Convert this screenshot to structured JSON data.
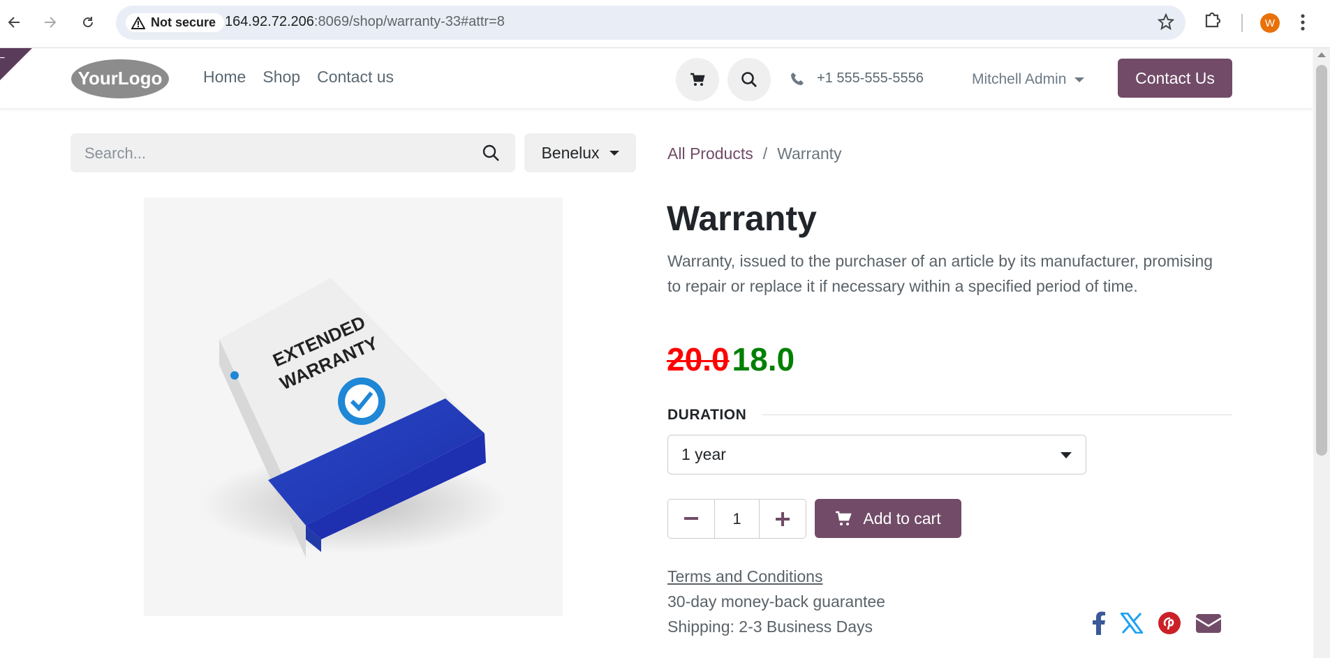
{
  "browser": {
    "security_label": "Not secure",
    "url_host": "164.92.72.206",
    "url_rest": ":8069/shop/warranty-33#attr=8",
    "profile_initial": "W"
  },
  "header": {
    "logo_text": "YourLogo",
    "menu": [
      "Home",
      "Shop",
      "Contact us"
    ],
    "phone": "+1 555-555-5556",
    "user": "Mitchell Admin",
    "cta": "Contact Us"
  },
  "search": {
    "placeholder": "Search...",
    "pricelist": "Benelux"
  },
  "breadcrumb": {
    "parent": "All Products",
    "separator": "/",
    "current": "Warranty"
  },
  "product": {
    "title": "Warranty",
    "description": "Warranty, issued to the purchaser of an article by its manufacturer, promising to repair or replace it if necessary within a specified period of time.",
    "old_price": "20.0",
    "price": "18.0",
    "image_text_1": "EXTENDED",
    "image_text_2": "WARRANTY",
    "attribute_label": "DURATION",
    "attribute_value": "1 year",
    "quantity": "1",
    "add_to_cart": "Add to cart",
    "terms": "Terms and Conditions",
    "guarantee": "30-day money-back guarantee",
    "shipping": "Shipping: 2-3 Business Days"
  },
  "colors": {
    "brand": "#714b67",
    "old_price": "#ff0000",
    "new_price": "#008000"
  }
}
